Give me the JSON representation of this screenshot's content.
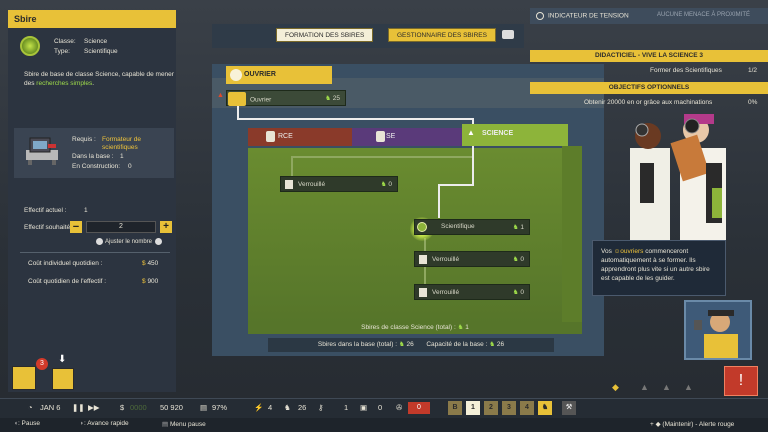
{
  "left_panel": {
    "title": "Sbire",
    "class_label": "Classe:",
    "class_value": "Science",
    "type_label": "Type:",
    "type_value": "Scientifique",
    "desc_pre": "Sbire de base de classe Science, capable de mener des ",
    "desc_link": "recherches simples",
    "desc_post": ".",
    "req_label": "Requis :",
    "req_value": "Formateur de scientifiques",
    "in_base_label": "Dans la base :",
    "in_base_value": "1",
    "in_build_label": "En Construction:",
    "in_build_value": "0",
    "effectif_actuel_label": "Effectif actuel :",
    "effectif_actuel_value": "1",
    "effectif_souhaite_label": "Effectif souhaité :",
    "effectif_souhaite_value": "2",
    "adjust_label": "Ajuster le nombre",
    "cout_indiv_label": "Coût individuel quotidien :",
    "cout_indiv_value": "450",
    "cout_effectif_label": "Coût quotidien de l'effectif :",
    "cout_effectif_value": "900"
  },
  "top_tabs": {
    "tab1": "FORMATION DES SBIRES",
    "tab2": "GESTIONNAIRE DES SBIRES"
  },
  "tree": {
    "ouvrier_header": "OUVRIER",
    "ouvrier_label": "Ouvrier",
    "ouvrier_count": "25",
    "tab_force": "RCE",
    "tab_base": "SE",
    "tab_science": "SCIENCE",
    "locked1_label": "Verrouillé",
    "locked1_count": "0",
    "scientifique_label": "Scientifique",
    "scientifique_count": "1",
    "locked2_label": "Verrouillé",
    "locked2_count": "0",
    "locked3_label": "Verrouillé",
    "locked3_count": "0",
    "science_total_label": "Sbires de classe Science (total) :",
    "science_total_value": "1",
    "base_total_label": "Sbires dans la base (total) :",
    "base_total_value": "26",
    "capacity_label": "Capacité de la base :",
    "capacity_value": "26"
  },
  "right_panel": {
    "tension_label": "INDICATEUR DE TENSION",
    "tension_status": "AUCUNE MENACE À PROXIMITÉ",
    "tutorial_title": "DIDACTICIEL - VIVE LA SCIENCE 3",
    "tutorial_task": "Former des Scientifiques",
    "tutorial_progress": "1/2",
    "optional_title": "OBJECTIFS OPTIONNELS",
    "optional_task": "Obtenir 20000 en or grâce aux machinations",
    "optional_progress": "0%",
    "tip_pre": "Vos ",
    "tip_link": "ouvriers",
    "tip_post": " commenceront automatiquement à se former. Ils apprendront plus vite si un autre sbire est capable de les guider."
  },
  "bottom_bar": {
    "date": "JAN 6",
    "money_ghost": "0000",
    "money": "50 920",
    "percent": "97%",
    "power": "4",
    "minions": "26",
    "key_value": "1",
    "intel": "0",
    "heat": "0",
    "notif_count": "3",
    "alert_symbol": "!",
    "speed_slots": [
      "B",
      "1",
      "2",
      "3",
      "4"
    ]
  },
  "hints": {
    "pause": ": Pause",
    "fast": ": Avance rapide",
    "menu": "Menu pause",
    "alert": "+ ◆ (Maintenir) - Alerte rouge"
  },
  "colors": {
    "accent": "#e8c138",
    "science": "#8db43a",
    "force": "#8a3a2a",
    "base": "#5a3a7a"
  }
}
